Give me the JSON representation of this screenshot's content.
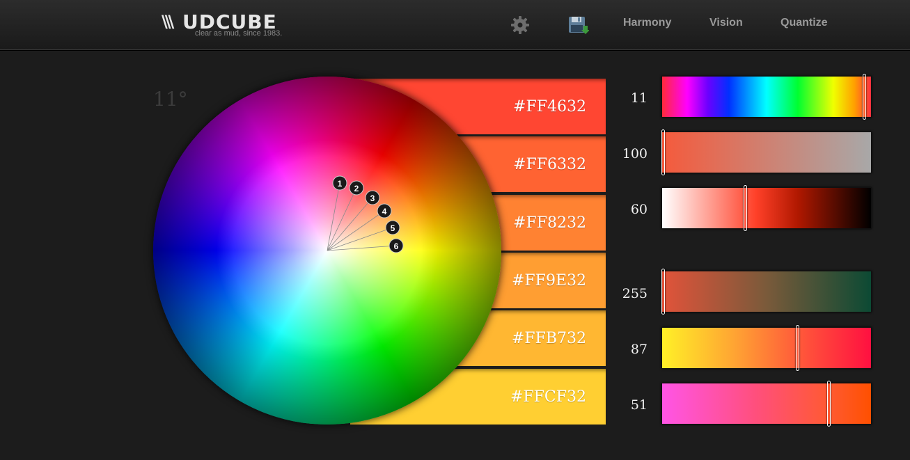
{
  "app": {
    "logo_text": "UDCUBE",
    "logo_wing": "\\\\\\",
    "tagline": "clear as mud, since 1983."
  },
  "nav": {
    "items": [
      {
        "label": "Harmony"
      },
      {
        "label": "Vision"
      },
      {
        "label": "Quantize"
      }
    ]
  },
  "wheel": {
    "angle": "11°",
    "markers": [
      "1",
      "2",
      "3",
      "4",
      "5",
      "6"
    ]
  },
  "swatches": [
    {
      "hex": "#FF4632",
      "color": "#ff4632"
    },
    {
      "hex": "#FF6332",
      "color": "#ff6332"
    },
    {
      "hex": "#FF8232",
      "color": "#ff8232"
    },
    {
      "hex": "#FF9E32",
      "color": "#ff9e32"
    },
    {
      "hex": "#FFB732",
      "color": "#ffb732"
    },
    {
      "hex": "#FFCF32",
      "color": "#ffcf32"
    }
  ],
  "sliders": [
    {
      "value": "11",
      "level": 0.97,
      "gradient": "linear-gradient(to right,#ff2a3a,#ff00ff 12%,#6a00ff 22%,#0030ff 32%,#00ffff 50%,#00ff30 65%,#f0ff00 82%,#ffa000 92%,#ff3040)"
    },
    {
      "value": "100",
      "level": 0.0,
      "gradient": "linear-gradient(to right,#f55a3c,#a8a8a8)"
    },
    {
      "value": "60",
      "level": 0.4,
      "gradient": "linear-gradient(to right,#ffffff,#ff4028 45%,#b01800 65%,#000000)"
    },
    {
      "value": "255",
      "level": 0.0,
      "gradient": "linear-gradient(to right,#e2533a,#7a5a3a 50%,#0c4a34)"
    },
    {
      "value": "87",
      "level": 0.65,
      "gradient": "linear-gradient(to right,#fff027,#ffa333 35%,#ff5a3a 65%,#ff1040)"
    },
    {
      "value": "51",
      "level": 0.8,
      "gradient": "linear-gradient(to right,#ff55e6,#ff4f7c 45%,#ff5a32 80%,#ff5000)"
    }
  ],
  "colors": {
    "background": "#1c1c1c",
    "nav_text": "#9a9a9a"
  },
  "icons": {
    "settings": "gear-icon",
    "save": "save-icon"
  }
}
